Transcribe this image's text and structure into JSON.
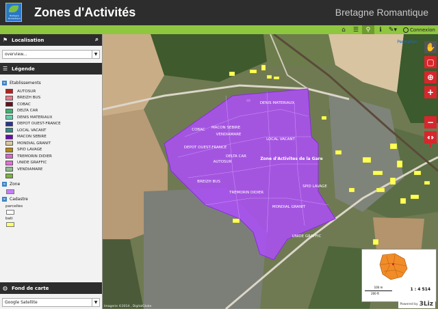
{
  "header": {
    "logo_text": "Bretagne Romantique",
    "title": "Zones d'Activités",
    "subtitle": "Bretagne Romantique"
  },
  "toolbar": {
    "icons": [
      "home-icon",
      "list-icon",
      "localisation-icon",
      "info-icon",
      "edit-icon"
    ],
    "connexion_label": "Connexion"
  },
  "localisation": {
    "title": "Localisation",
    "selected": "overview..."
  },
  "legende": {
    "title": "Légende",
    "etablissements": {
      "label": "Etablissements",
      "items": [
        {
          "label": "AUTOSUR",
          "color": "#b22222"
        },
        {
          "label": "BREIZH BUS",
          "color": "#e8798a"
        },
        {
          "label": "COBAC",
          "color": "#6b0f1a"
        },
        {
          "label": "DELTA CAR",
          "color": "#3cb371"
        },
        {
          "label": "DENIS MATERIAUX",
          "color": "#66cdaa"
        },
        {
          "label": "DEPOT OUEST-FRANCE",
          "color": "#283593"
        },
        {
          "label": "LOCAL VACANT",
          "color": "#2e8b8b"
        },
        {
          "label": "MACON SEBIRE",
          "color": "#6a0dad"
        },
        {
          "label": "MONDIAL GRANIT",
          "color": "#d8c9a0"
        },
        {
          "label": "SPID LAVAGE",
          "color": "#b8860b"
        },
        {
          "label": "TREMORIN DIDIER",
          "color": "#d966c9"
        },
        {
          "label": "UNIDE GRAFFIC",
          "color": "#e36fd4"
        },
        {
          "label": "VENDIAMARE",
          "color": "#8fbc8f"
        },
        {
          "label": "",
          "color": "#7cb342"
        }
      ]
    },
    "zone": {
      "label": "Zone",
      "color": "#c77dff"
    },
    "cadastre": {
      "label": "Cadastre",
      "parcelles_label": "parcelles",
      "bati_label": "bati",
      "parcelles_color": "#ffffff",
      "bati_color": "#ffff66"
    }
  },
  "fond_de_carte": {
    "title": "Fond de carte",
    "selected": "Google Satellite"
  },
  "map": {
    "permalien": "Permalien",
    "zone_title": "Zone d'Activites de la Gare",
    "labels": [
      "DENIS MATERIAUX",
      "COBAC",
      "MACON SEBIRE",
      "VENDIAMARE",
      "LOCAL VACANT",
      "DEPOT OUEST-FRANCE",
      "DELTA CAR",
      "AUTOSUR",
      "BREIZH BUS",
      "TREMORIN DIDIER",
      "SPID LAVAGE",
      "MONDIAL GRANIT",
      "UNIDE GRAFFIC"
    ],
    "scale": "1 : 4 514",
    "scalebar_m": "100 m",
    "scalebar_ft": "200 ft",
    "attribution": "Imagerie ©2014 , DigitalGlobe",
    "powered_by": "Powered by",
    "brand": "3Liz"
  }
}
